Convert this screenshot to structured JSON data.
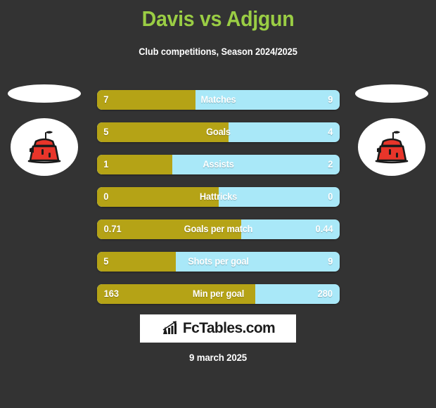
{
  "header": {
    "title": "Davis vs Adjgun",
    "subtitle": "Club competitions, Season 2024/2025",
    "title_color": "#9ACD44"
  },
  "crests": {
    "home": {
      "name": "tower-crest",
      "blank_label": ""
    },
    "away": {
      "name": "tower-crest",
      "blank_label": ""
    }
  },
  "colors": {
    "background": "#333333",
    "home_bar": "#B5A316",
    "away_bar": "#A9E8F8",
    "text": "#ffffff"
  },
  "chart_data": {
    "type": "bar",
    "title": "Davis vs Adjgun",
    "subtitle": "Club competitions, Season 2024/2025",
    "orientation": "horizontal-diverging",
    "series": [
      {
        "name": "Davis",
        "color": "#B5A316",
        "values": [
          7,
          5,
          1,
          0,
          0.71,
          5,
          163
        ]
      },
      {
        "name": "Adjgun",
        "color": "#A9E8F8",
        "values": [
          9,
          4,
          2,
          0,
          0.44,
          9,
          280
        ]
      }
    ],
    "categories": [
      "Matches",
      "Goals",
      "Assists",
      "Hattricks",
      "Goals per match",
      "Shots per goal",
      "Min per goal"
    ],
    "rows": [
      {
        "label": "Matches",
        "home": "7",
        "away": "9",
        "fill_pct": 40.5
      },
      {
        "label": "Goals",
        "home": "5",
        "away": "4",
        "fill_pct": 54.2
      },
      {
        "label": "Assists",
        "home": "1",
        "away": "2",
        "fill_pct": 31.0
      },
      {
        "label": "Hattricks",
        "home": "0",
        "away": "0",
        "fill_pct": 50.0
      },
      {
        "label": "Goals per match",
        "home": "0.71",
        "away": "0.44",
        "fill_pct": 59.5
      },
      {
        "label": "Shots per goal",
        "home": "5",
        "away": "9",
        "fill_pct": 32.5
      },
      {
        "label": "Min per goal",
        "home": "163",
        "away": "280",
        "fill_pct": 65.2
      }
    ],
    "grid": false,
    "legend": "none"
  },
  "footer": {
    "logo_text": "FcTables.com",
    "logo_icon": "bar-chart-arrow-icon",
    "date": "9 march 2025"
  }
}
